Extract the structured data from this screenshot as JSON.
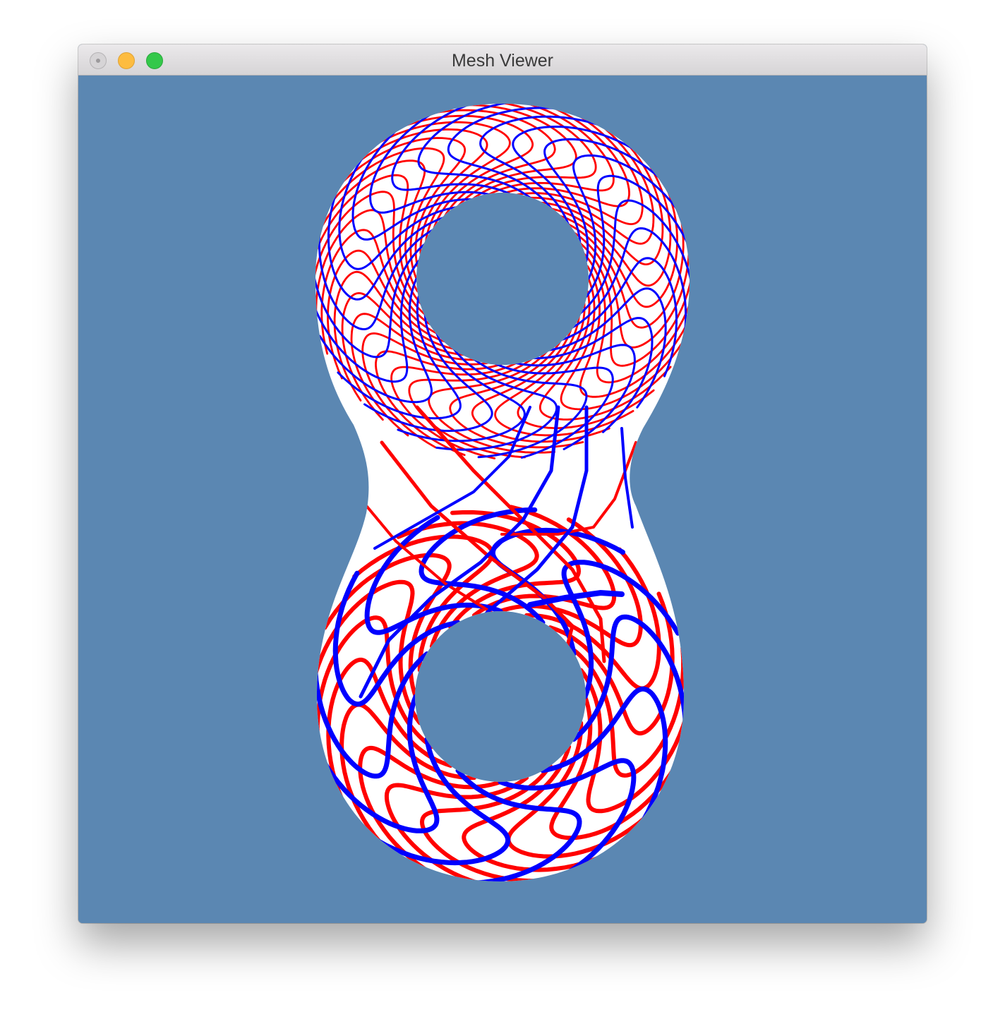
{
  "window": {
    "title": "Mesh Viewer",
    "buttons": {
      "close": "close-icon",
      "minimize": "minimize-icon",
      "zoom": "zoom-icon"
    }
  },
  "viewport": {
    "background_color": "#5b87b2",
    "mesh": {
      "fill_color": "#ffffff",
      "u_line_color": "#ff0000",
      "v_line_color": "#0000ff"
    }
  }
}
